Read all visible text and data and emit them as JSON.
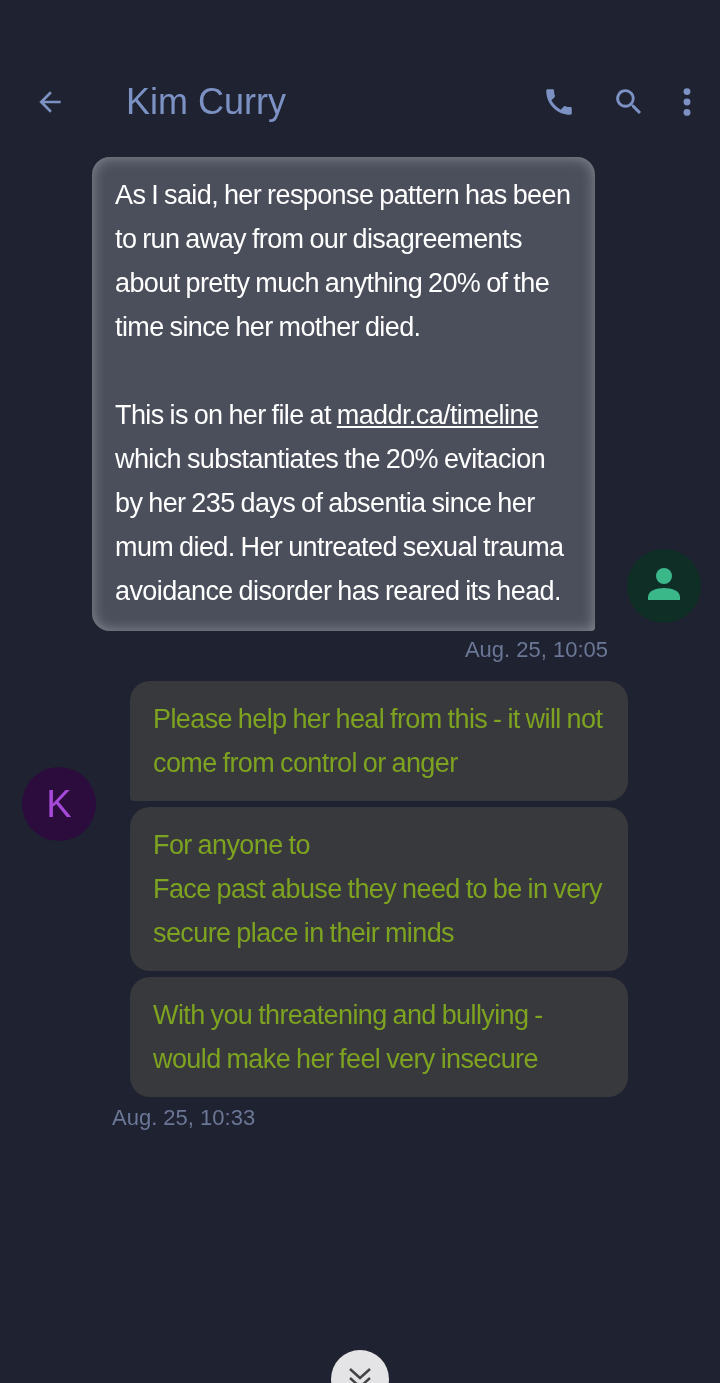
{
  "header": {
    "title": "Kim Curry"
  },
  "outgoing": {
    "paragraphs": [
      {
        "before": "As I said, her response pattern has been to run away from our disagreements about pretty much anything 20% of the time since her mother died."
      },
      {
        "before": "This is on her file at",
        "link": "maddr.ca/timeline",
        "after": "which substantiates the 20% evitacion by her 235 days of absentia since her mum died. Her untreated sexual trauma avoidance disorder has reared its head."
      }
    ],
    "time": "Aug. 25, 10:05"
  },
  "incoming": {
    "avatar_letter": "K",
    "messages": [
      "Please help her heal from this - it will not come from control or anger",
      "For anyone to\nFace past abuse they need to be in very secure place in their minds",
      "With you threatening and bullying - would make her feel very insecure"
    ],
    "time": "Aug. 25, 10:33"
  }
}
